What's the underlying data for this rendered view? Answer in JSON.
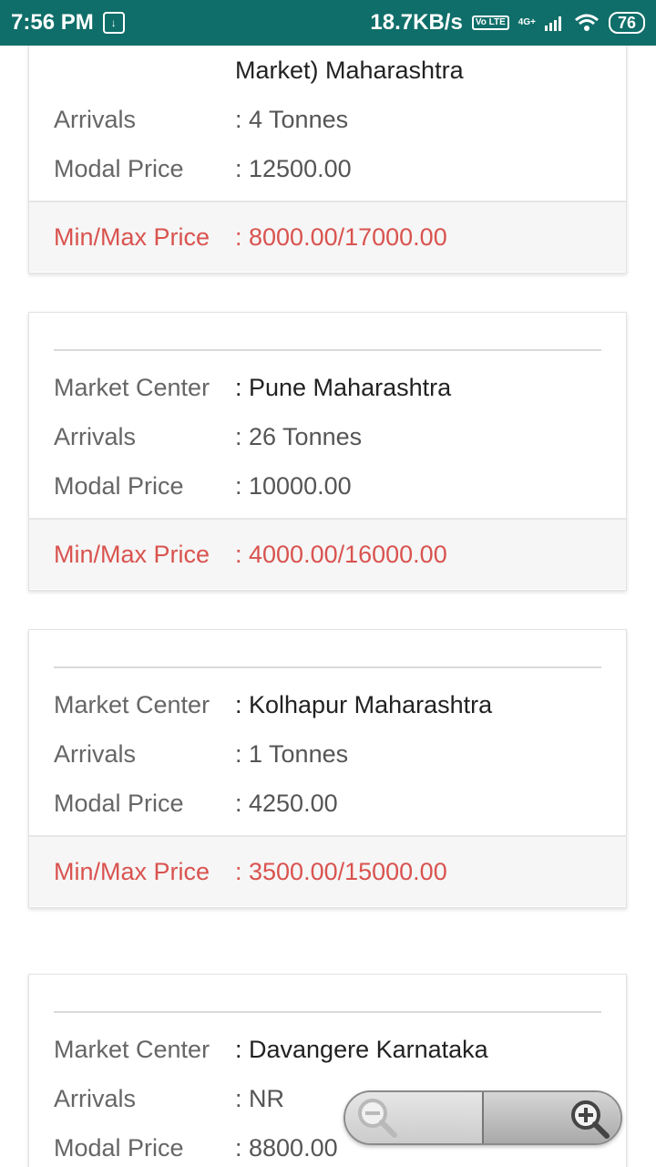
{
  "statusbar": {
    "time": "7:56 PM",
    "speed": "18.7KB/s",
    "volte": "Vo LTE",
    "network": "4G+",
    "battery": "76"
  },
  "cards": [
    {
      "market_continuation": "Market) Maharashtra",
      "arrivals_label": "Arrivals",
      "arrivals_value": ": 4 Tonnes",
      "modal_label": "Modal Price",
      "modal_value": ": 12500.00",
      "minmax_label": "Min/Max Price",
      "minmax_value": ": 8000.00/17000.00"
    },
    {
      "market_label": "Market Center",
      "market_value": ": Pune Maharashtra",
      "arrivals_label": "Arrivals",
      "arrivals_value": ": 26 Tonnes",
      "modal_label": "Modal Price",
      "modal_value": ": 10000.00",
      "minmax_label": "Min/Max Price",
      "minmax_value": ": 4000.00/16000.00"
    },
    {
      "market_label": "Market Center",
      "market_value": ": Kolhapur Maharashtra",
      "arrivals_label": "Arrivals",
      "arrivals_value": ": 1 Tonnes",
      "modal_label": "Modal Price",
      "modal_value": ": 4250.00",
      "minmax_label": "Min/Max Price",
      "minmax_value": ": 3500.00/15000.00"
    },
    {
      "market_label": "Market Center",
      "market_value": ": Davangere Karnataka",
      "arrivals_label": "Arrivals",
      "arrivals_value": ": NR",
      "modal_label": "Modal Price",
      "modal_value": ": 8800.00"
    }
  ],
  "zoom": {
    "out_icon": "zoom-out-icon",
    "in_icon": "zoom-in-icon"
  },
  "colors": {
    "statusbar": "#0f6e69",
    "price_red": "#d9534f"
  }
}
